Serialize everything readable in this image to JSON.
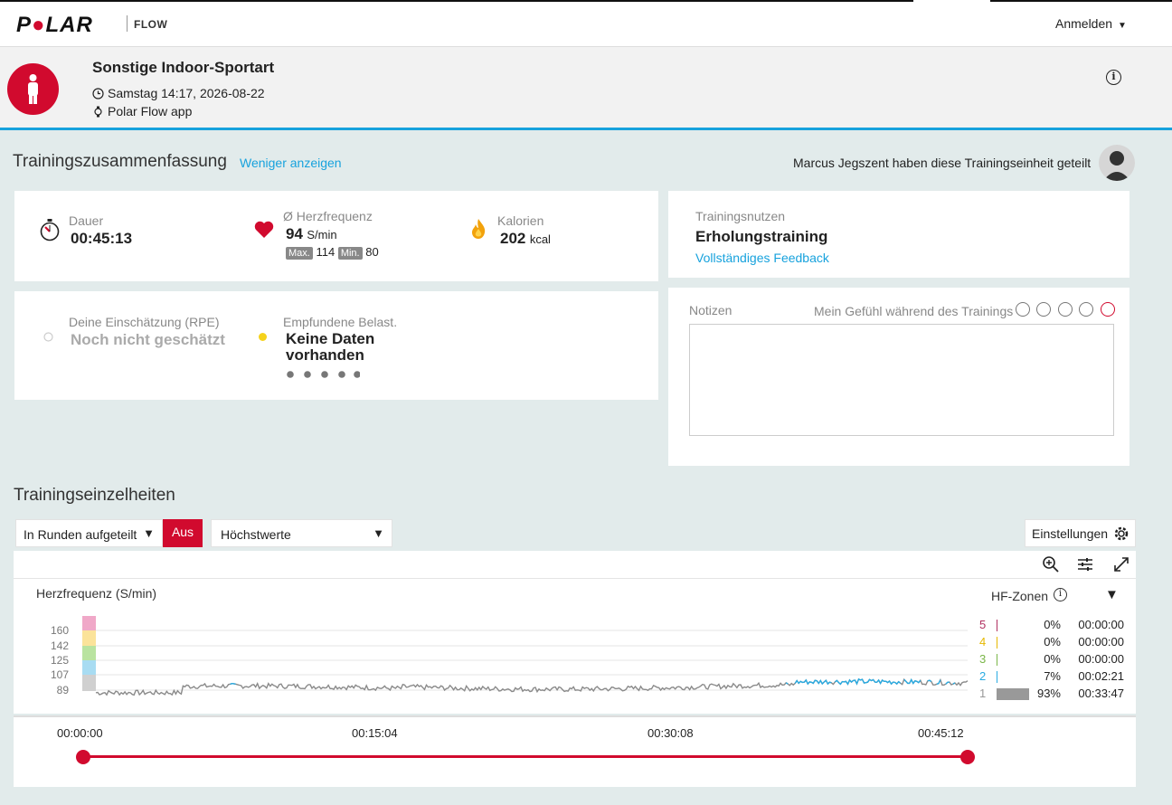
{
  "topbar": {
    "logo": "POLAR",
    "product": "FLOW",
    "login_label": "Anmelden"
  },
  "header": {
    "sport_title": "Sonstige Indoor-Sportart",
    "date": "Samstag 14:17, 2026-08-22",
    "source": "Polar Flow app"
  },
  "summary": {
    "title": "Trainingszusammenfassung",
    "less_link": "Weniger anzeigen",
    "shared_text": "Marcus Jegszent haben diese Trainingseinheit geteilt",
    "duration": {
      "label": "Dauer",
      "value": "00:45:13"
    },
    "heart_rate": {
      "label": "Ø Herzfrequenz",
      "value": "94",
      "unit": "S/min",
      "max_label": "Max.",
      "max_value": "114",
      "min_label": "Min.",
      "min_value": "80"
    },
    "calories": {
      "label": "Kalorien",
      "value": "202",
      "unit": "kcal"
    },
    "benefit": {
      "label": "Trainingsnutzen",
      "value": "Erholungstraining",
      "link": "Vollständiges Feedback"
    },
    "rpe": {
      "label": "Deine Einschätzung (RPE)",
      "value": "Noch nicht geschätzt"
    },
    "load": {
      "label": "Empfundene Belast.",
      "value_line1": "Keine Daten",
      "value_line2": "vorhanden"
    },
    "notes": {
      "label": "Notizen",
      "feeling_label": "Mein Gefühl während des Trainings"
    }
  },
  "details": {
    "title": "Trainingseinzelheiten",
    "laps_select": "In Runden aufgeteilt",
    "laps_toggle": "Aus",
    "values_select": "Höchstwerte",
    "settings_label": "Einstellungen",
    "chart_title": "Herzfrequenz (S/min)",
    "zones_label": "HF-Zonen",
    "zones": [
      {
        "zone": "5",
        "pct": "0%",
        "time": "00:00:00",
        "color": "#b03060"
      },
      {
        "zone": "4",
        "pct": "0%",
        "time": "00:00:00",
        "color": "#e6b800"
      },
      {
        "zone": "3",
        "pct": "0%",
        "time": "00:00:00",
        "color": "#7ab648"
      },
      {
        "zone": "2",
        "pct": "7%",
        "time": "00:02:21",
        "color": "#29abe2"
      },
      {
        "zone": "1",
        "pct": "93%",
        "time": "00:33:47",
        "color": "#999999"
      }
    ],
    "y_ticks": [
      "160",
      "142",
      "125",
      "107",
      "89"
    ],
    "timeline": [
      "00:00:00",
      "00:15:04",
      "00:30:08",
      "00:45:12"
    ]
  },
  "colors": {
    "accent_red": "#d10a2e",
    "accent_blue": "#17a2dd"
  }
}
